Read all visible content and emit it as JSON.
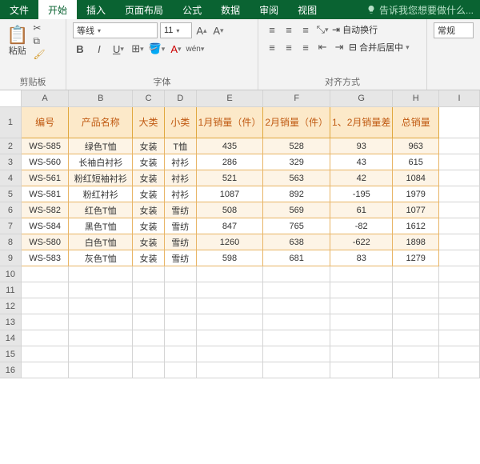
{
  "tabs": {
    "file": "文件",
    "items": [
      "开始",
      "插入",
      "页面布局",
      "公式",
      "数据",
      "审阅",
      "视图"
    ],
    "active": 0,
    "tell": "告诉我您想要做什么..."
  },
  "ribbon": {
    "clipboard": {
      "paste": "粘贴",
      "label": "剪贴板"
    },
    "font": {
      "name": "等线",
      "size": "11",
      "label": "字体"
    },
    "align": {
      "wrap": "自动换行",
      "merge": "合并后居中",
      "label": "对齐方式"
    },
    "other": {
      "label": "常规"
    }
  },
  "columns": [
    "A",
    "B",
    "C",
    "D",
    "E",
    "F",
    "G",
    "H",
    "I"
  ],
  "widths": [
    60,
    80,
    40,
    40,
    60,
    60,
    60,
    58,
    52
  ],
  "headerRow": [
    "编号",
    "产品名称",
    "大类",
    "小类",
    "1月销量（件）",
    "2月销量（件）",
    "1、2月销量差",
    "总销量"
  ],
  "rows": [
    [
      "WS-585",
      "绿色T恤",
      "女装",
      "T恤",
      "435",
      "528",
      "93",
      "963"
    ],
    [
      "WS-560",
      "长袖白衬衫",
      "女装",
      "衬衫",
      "286",
      "329",
      "43",
      "615"
    ],
    [
      "WS-561",
      "粉红短袖衬衫",
      "女装",
      "衬衫",
      "521",
      "563",
      "42",
      "1084"
    ],
    [
      "WS-581",
      "粉红衬衫",
      "女装",
      "衬衫",
      "1087",
      "892",
      "-195",
      "1979"
    ],
    [
      "WS-582",
      "红色T恤",
      "女装",
      "雪纺",
      "508",
      "569",
      "61",
      "1077"
    ],
    [
      "WS-584",
      "黑色T恤",
      "女装",
      "雪纺",
      "847",
      "765",
      "-82",
      "1612"
    ],
    [
      "WS-580",
      "白色T恤",
      "女装",
      "雪纺",
      "1260",
      "638",
      "-622",
      "1898"
    ],
    [
      "WS-583",
      "灰色T恤",
      "女装",
      "雪纺",
      "598",
      "681",
      "83",
      "1279"
    ]
  ],
  "blankRows": 7
}
